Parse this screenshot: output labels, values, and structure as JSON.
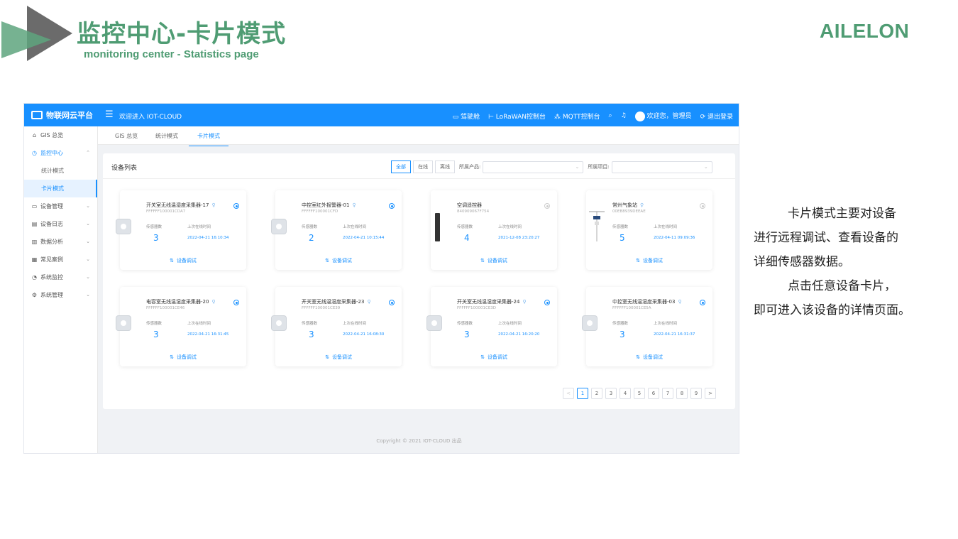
{
  "slide": {
    "title": "监控中心-卡片模式",
    "subtitle": "monitoring center - Statistics page",
    "brand": "AILELON",
    "colors": {
      "accent": "#4f9c73",
      "app_primary": "#1890ff"
    }
  },
  "app": {
    "platform_name": "物联网云平台",
    "welcome": "欢迎进入 IOT-CLOUD",
    "top_links": {
      "dashboard": "驾驶舱",
      "lorawan": "LoRaWAN控制台",
      "mqtt": "MQTT控制台",
      "user": "欢迎您，管理员",
      "logout": "退出登录"
    },
    "sidebar": {
      "gis": "GIS 总览",
      "monitor": "监控中心",
      "monitor_stats": "统计模式",
      "monitor_card": "卡片模式",
      "device_mgmt": "设备管理",
      "device_log": "设备日志",
      "data_analysis": "数据分析",
      "common_cases": "常见案例",
      "sys_monitor": "系统监控",
      "sys_mgmt": "系统管理"
    },
    "tabs": {
      "gis": "GIS 总览",
      "stats": "统计模式",
      "card": "卡片模式"
    },
    "panel": {
      "title": "设备列表",
      "filter_all": "全部",
      "filter_online": "在线",
      "filter_offline": "离线",
      "product_label": "所属产品:",
      "project_label": "所属项目:"
    },
    "card_labels": {
      "sensor_count": "传感器数",
      "last_online": "上次在线时间",
      "debug": "设备调试"
    },
    "devices": [
      {
        "name": "开关室无线温湿度采集器-17",
        "id": "FFFFFF100001CDA7",
        "count": "3",
        "time": "2022-04-21 16:10:34"
      },
      {
        "name": "中控室红外报警器-01",
        "id": "FFFFFF100001CFD",
        "count": "2",
        "time": "2022-04-21 10:15:44"
      },
      {
        "name": "空调遥控器",
        "id": "840909067F754",
        "count": "4",
        "time": "2021-12-08 23:20:27"
      },
      {
        "name": "常州气象站",
        "id": "00EB8939DEEAE",
        "count": "5",
        "time": "2022-04-11 09:09:36"
      },
      {
        "name": "电容室无线温湿度采集器-20",
        "id": "FFFFFF100001CE46",
        "count": "3",
        "time": "2022-04-21 16:31:45"
      },
      {
        "name": "开关室无线温湿度采集器-23",
        "id": "FFFFFF100001CE39",
        "count": "3",
        "time": "2022-04-21 16:08:30"
      },
      {
        "name": "开关室无线温湿度采集器-24",
        "id": "FFFFFF100001CE3D",
        "count": "3",
        "time": "2022-04-21 16:20:20"
      },
      {
        "name": "中控室无线温湿度采集器-03",
        "id": "FFFFFF100001CE5A",
        "count": "3",
        "time": "2022-04-21 16:31:37"
      }
    ],
    "pagination": {
      "prev": "<",
      "pages": [
        "1",
        "2",
        "3",
        "4",
        "5",
        "6",
        "7",
        "8",
        "9"
      ],
      "next": ">",
      "current": "1"
    },
    "copyright": "Copyright © 2021 IOT-CLOUD 出品"
  },
  "description": {
    "line1": "卡片模式主要对设备",
    "line2": "进行远程调试、查看设备的",
    "line3": "详细传感器数据。",
    "line4": "点击任意设备卡片，",
    "line5": "即可进入该设备的详情页面。"
  }
}
